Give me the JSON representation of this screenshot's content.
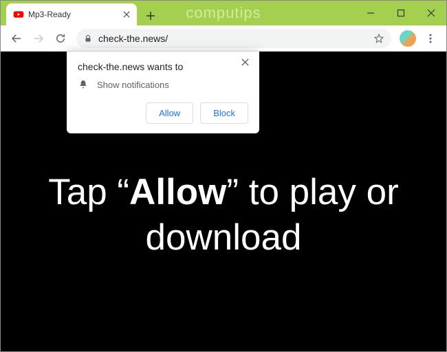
{
  "window": {
    "watermark": "computips"
  },
  "tab": {
    "title": "Mp3-Ready",
    "favicon": "youtube"
  },
  "toolbar": {
    "url": "check-the.news/"
  },
  "popup": {
    "title": "check-the.news wants to",
    "message": "Show notifications",
    "allow_label": "Allow",
    "block_label": "Block"
  },
  "page": {
    "prefix": "Tap “",
    "bold": "Allow",
    "suffix": "” to play or download"
  }
}
